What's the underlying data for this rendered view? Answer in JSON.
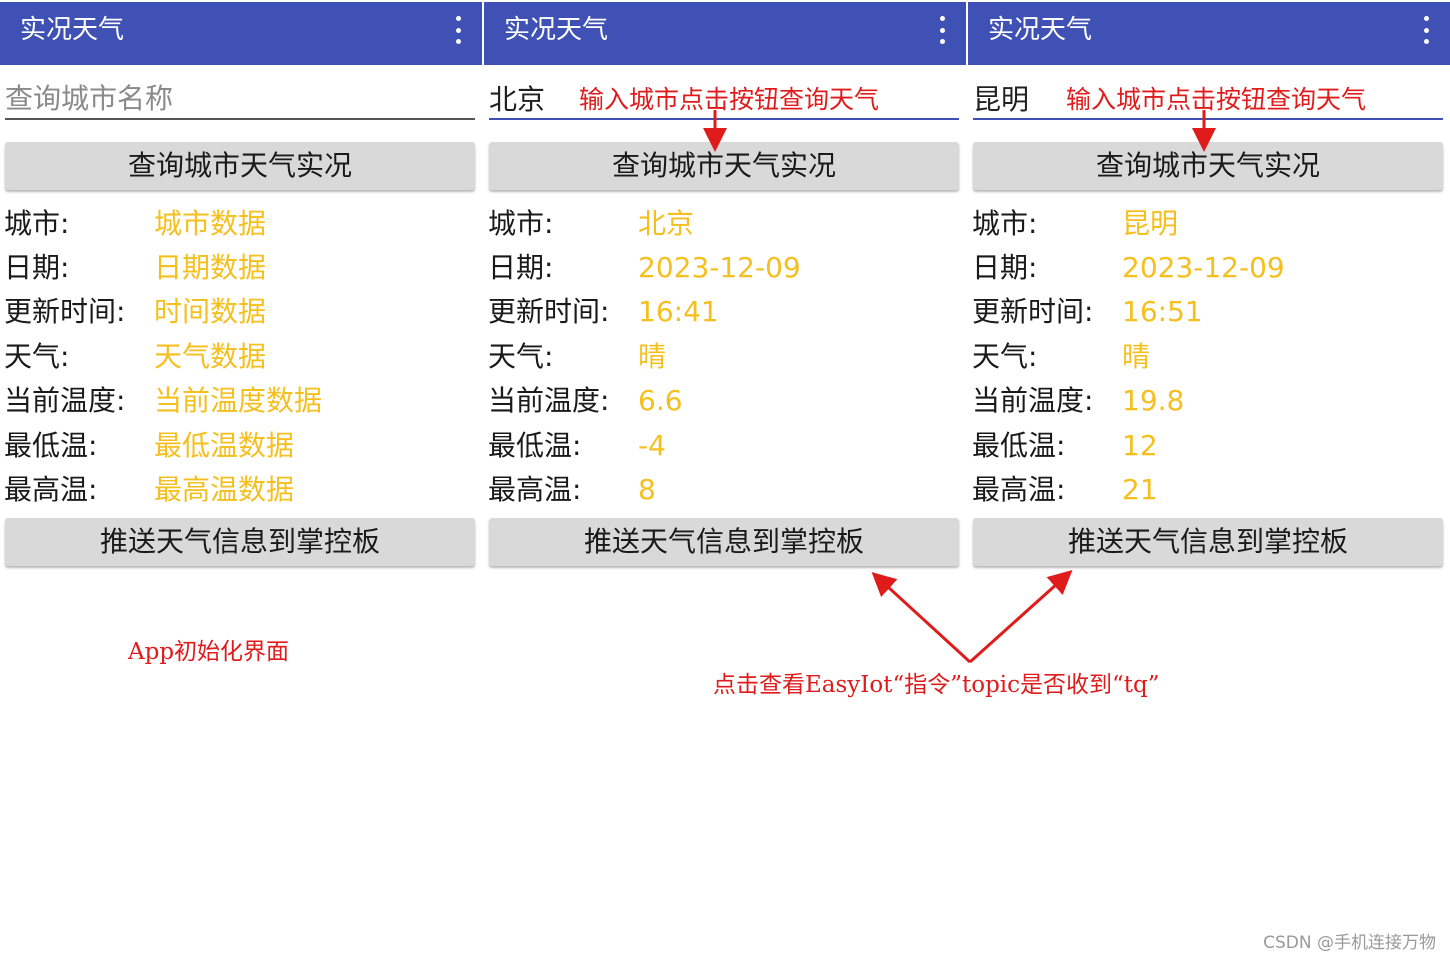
{
  "panels": [
    {
      "title": "实况天气",
      "city_input_value": "",
      "city_input_placeholder": "查询城市名称",
      "query_button": "查询城市天气实况",
      "push_button": "推送天气信息到掌控板",
      "rows": [
        {
          "label": "城市:",
          "value": "城市数据"
        },
        {
          "label": "日期:",
          "value": "日期数据"
        },
        {
          "label": "更新时间:",
          "value": "时间数据"
        },
        {
          "label": "天气:",
          "value": "天气数据"
        },
        {
          "label": "当前温度:",
          "value": "当前温度数据"
        },
        {
          "label": "最低温:",
          "value": "最低温数据"
        },
        {
          "label": "最高温:",
          "value": "最高温数据"
        }
      ]
    },
    {
      "title": "实况天气",
      "city_input_value": "北京",
      "city_input_placeholder": "查询城市名称",
      "query_button": "查询城市天气实况",
      "push_button": "推送天气信息到掌控板",
      "rows": [
        {
          "label": "城市:",
          "value": "北京"
        },
        {
          "label": "日期:",
          "value": "2023-12-09"
        },
        {
          "label": "更新时间:",
          "value": "16:41"
        },
        {
          "label": "天气:",
          "value": "晴"
        },
        {
          "label": "当前温度:",
          "value": "6.6"
        },
        {
          "label": "最低温:",
          "value": "-4"
        },
        {
          "label": "最高温:",
          "value": "8"
        }
      ]
    },
    {
      "title": "实况天气",
      "city_input_value": "昆明",
      "city_input_placeholder": "查询城市名称",
      "query_button": "查询城市天气实况",
      "push_button": "推送天气信息到掌控板",
      "rows": [
        {
          "label": "城市:",
          "value": "昆明"
        },
        {
          "label": "日期:",
          "value": "2023-12-09"
        },
        {
          "label": "更新时间:",
          "value": "16:51"
        },
        {
          "label": "天气:",
          "value": "晴"
        },
        {
          "label": "当前温度:",
          "value": "19.8"
        },
        {
          "label": "最低温:",
          "value": "12"
        },
        {
          "label": "最高温:",
          "value": "21"
        }
      ]
    }
  ],
  "annotations": {
    "input_hint_1": "输入城市点击按钮查询天气",
    "input_hint_2": "输入城市点击按钮查询天气",
    "init_caption": "App初始化界面",
    "push_caption": "点击查看EasyIot“指令”topic是否收到“tq”"
  },
  "watermark": "CSDN @手机连接万物",
  "colors": {
    "appbar": "#3f51b5",
    "value_text": "#f5bf1d",
    "annotation": "#e01b1b",
    "button": "#d9d9d9"
  },
  "icons": {
    "overflow_menu": "more-vert-icon"
  }
}
